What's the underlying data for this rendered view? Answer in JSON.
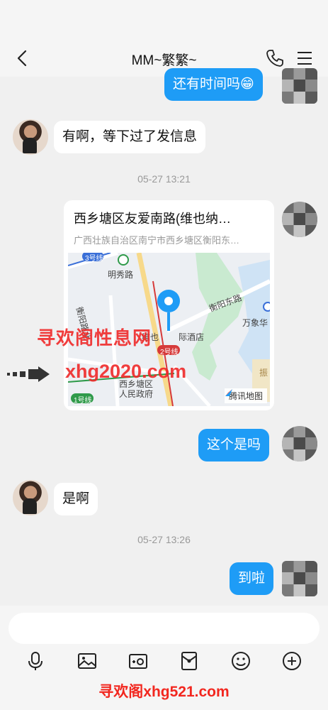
{
  "header": {
    "title": "MM~繁繁~"
  },
  "messages": {
    "msg1": {
      "text": "还有时间吗😁",
      "direction": "outgoing"
    },
    "msg2": {
      "text": "有啊，等下过了发信息",
      "direction": "incoming"
    },
    "time1": "05-27 13:21",
    "location": {
      "title": "西乡塘区友爱南路(维也纳…",
      "address": "广西壮族自治区南宁市西乡塘区衡阳东…",
      "map": {
        "labels": {
          "mingxiu": "明秀路",
          "hengyang_east": "衡阳东路",
          "hengyang_north": "衡阳路北",
          "wanxiang": "万象华",
          "hotel": "维也",
          "hotel2": "际酒店",
          "gov1": "西乡塘区",
          "gov2": "人民政府",
          "line1": "1号线",
          "line2": "2号线",
          "line3": "3号线",
          "zhen": "振"
        },
        "brand": "腾讯地图"
      }
    },
    "msg3": {
      "text": "这个是吗",
      "direction": "outgoing"
    },
    "msg4": {
      "text": "是啊",
      "direction": "incoming"
    },
    "time2": "05-27 13:26",
    "msg5": {
      "text": "到啦",
      "direction": "outgoing"
    }
  },
  "watermarks": {
    "line1": "寻欢阁性息网",
    "line2": "xhg2020.com",
    "line3": "寻欢阁xhg521.com"
  },
  "colors": {
    "accent": "#1e9cf6",
    "background": "#f0f0f0",
    "watermark": "#f2271f"
  },
  "toolbar": {
    "icons": [
      "microphone-icon",
      "image-icon",
      "camera-icon",
      "red-packet-icon",
      "emoji-icon",
      "plus-icon"
    ]
  }
}
